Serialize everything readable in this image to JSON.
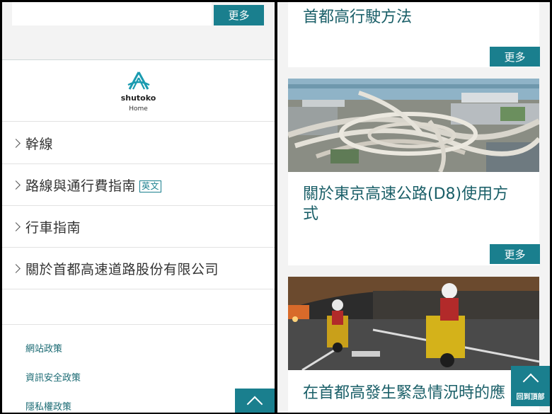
{
  "left_panel": {
    "top_card": {
      "more_label": "更多"
    },
    "logo": {
      "brand": "shutoko",
      "home_label": "Home"
    },
    "nav": [
      {
        "label": "幹線"
      },
      {
        "label": "路線與通行費指南",
        "badge": "英文"
      },
      {
        "label": "行車指南"
      },
      {
        "label": "關於首都高速道路股份有限公司"
      }
    ],
    "footer_links": [
      "網站政策",
      "資訊安全政策",
      "隱私權政策"
    ]
  },
  "right_panel": {
    "cards": [
      {
        "title": "首都高行駛方法",
        "more_label": "更多"
      },
      {
        "title_line1": "關於東京高速公路(D8)使用方",
        "title_line2": "式",
        "more_label": "更多"
      },
      {
        "title": "在首都高發生緊急情況時的應"
      }
    ],
    "back_to_top_label": "回到頂部"
  },
  "colors": {
    "accent": "#1a7f8e",
    "title_text": "#1a5f68",
    "panel_bg": "#f3f3f3",
    "divider": "#000000"
  }
}
